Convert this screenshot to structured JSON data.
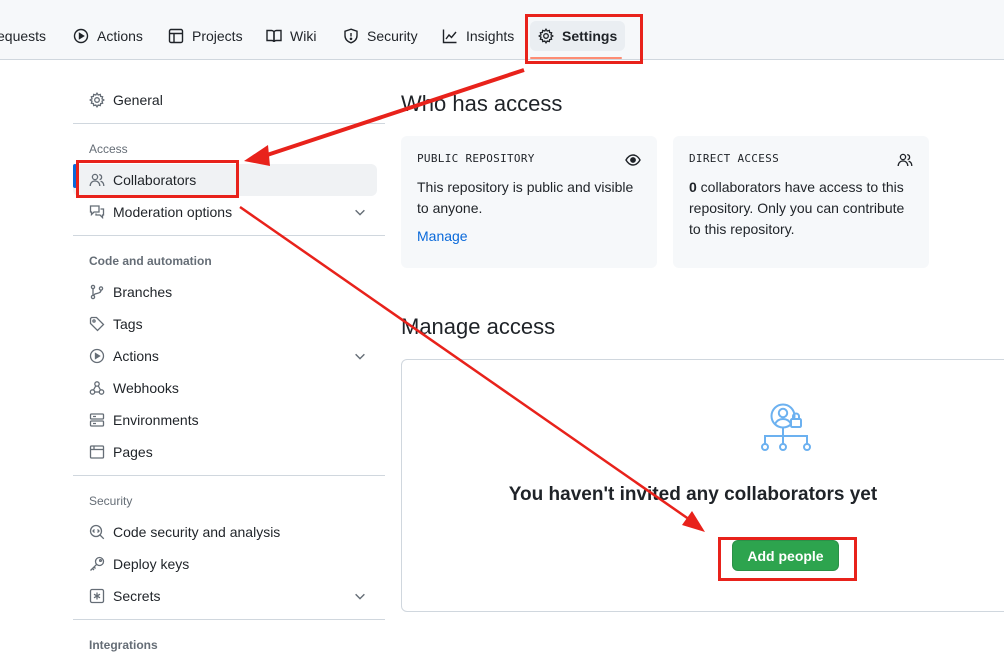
{
  "nav": {
    "tabs": [
      {
        "label": "equests",
        "icon": "pull-request-icon"
      },
      {
        "label": "Actions",
        "icon": "play-icon"
      },
      {
        "label": "Projects",
        "icon": "table-icon"
      },
      {
        "label": "Wiki",
        "icon": "book-icon"
      },
      {
        "label": "Security",
        "icon": "shield-icon"
      },
      {
        "label": "Insights",
        "icon": "graph-icon"
      },
      {
        "label": "Settings",
        "icon": "gear-icon",
        "selected": true
      }
    ]
  },
  "sidebar": {
    "general": "General",
    "access_heading": "Access",
    "collaborators": "Collaborators",
    "moderation": "Moderation options",
    "code_heading": "Code and automation",
    "branches": "Branches",
    "tags": "Tags",
    "actions": "Actions",
    "webhooks": "Webhooks",
    "environments": "Environments",
    "pages": "Pages",
    "security_heading": "Security",
    "code_security": "Code security and analysis",
    "deploy_keys": "Deploy keys",
    "secrets": "Secrets",
    "integrations_heading": "Integrations"
  },
  "main": {
    "who_title": "Who has access",
    "public_card": {
      "title": "PUBLIC REPOSITORY",
      "body": "This repository is public and visible to anyone.",
      "link": "Manage"
    },
    "direct_card": {
      "title": "DIRECT ACCESS",
      "count": "0",
      "body": " collaborators have access to this repository. Only you can contribute to this repository."
    },
    "manage_title": "Manage access",
    "empty_title": "You haven't invited any collaborators yet",
    "add_button": "Add people"
  },
  "colors": {
    "annotation": "#e8221b",
    "primary_button": "#2da44e",
    "link": "#0969da",
    "selected_tab_underline": "#fd8c73"
  }
}
